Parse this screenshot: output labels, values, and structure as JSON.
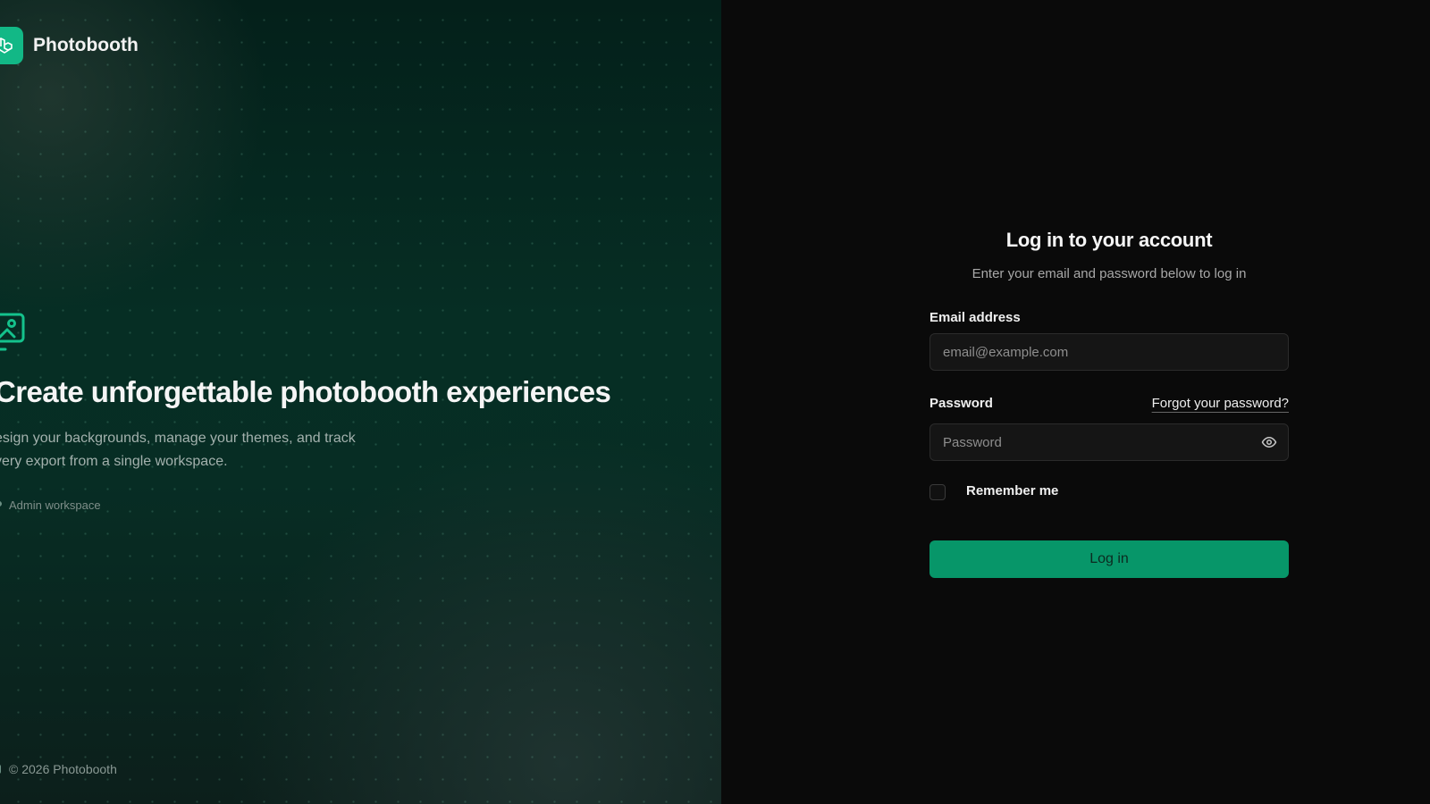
{
  "brand": {
    "name": "Photobooth",
    "icon": "laravel-logo-icon",
    "accent": "#12b886"
  },
  "hero": {
    "icon": "image-plus-icon",
    "title": "Create unforgettable photobooth experiences",
    "description": "esign your backgrounds, manage your themes, and track very export from a single workspace.",
    "badge": "Admin workspace"
  },
  "footer": {
    "copyright": "© 2026 Photobooth"
  },
  "form": {
    "title": "Log in to your account",
    "subtitle": "Enter your email and password below to log in",
    "email_label": "Email address",
    "email_placeholder": "email@example.com",
    "email_value": "",
    "password_label": "Password",
    "forgot_label": "Forgot your password?",
    "password_placeholder": "Password",
    "password_value": "",
    "remember_label": "Remember me",
    "remember_checked": false,
    "submit_label": "Log in",
    "submit_color": "#079669"
  }
}
